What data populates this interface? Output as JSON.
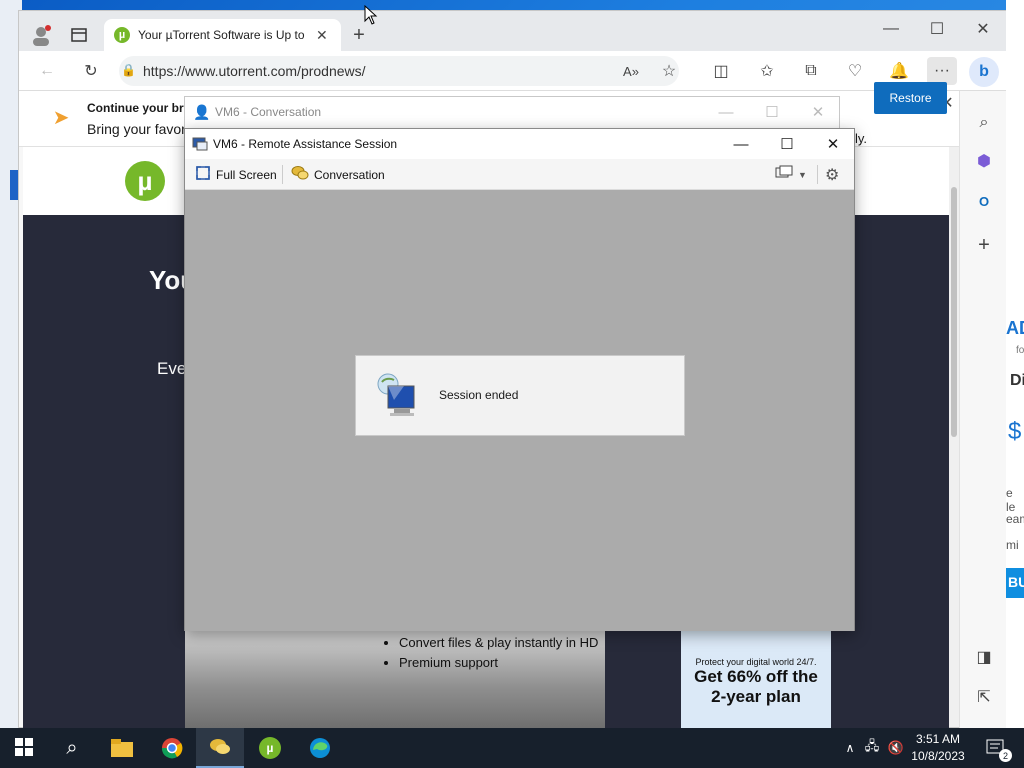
{
  "browser": {
    "tab_title": "Your µTorrent Software is Up to D",
    "url": "https://www.utorrent.com/prodnews/",
    "banner_title": "Continue your bro",
    "banner_text": "Bring your favor",
    "restore_label": "Restore",
    "banner_trailing_text": "ly."
  },
  "page": {
    "hero_title": "You",
    "hero_sub": "Eve",
    "features": [
      "Convert files & play instantly in HD",
      "Premium support"
    ],
    "ad_small": "Protect your digital world 24/7.",
    "ad_big_1": "Get 66% off the",
    "ad_big_2": "2-year plan",
    "right_strip_texts": [
      "AD",
      "fo",
      "Di",
      "$",
      "e le",
      "eam",
      "mi",
      "BU"
    ]
  },
  "conversation_window": {
    "title": "VM6 - Conversation"
  },
  "remote_assistance": {
    "title": "VM6 - Remote Assistance Session",
    "toolbar": {
      "full_screen": "Full Screen",
      "conversation": "Conversation"
    },
    "session_message": "Session ended"
  },
  "taskbar": {
    "time": "3:51 AM",
    "date": "10/8/2023",
    "notification_count": "2"
  },
  "colors": {
    "accent": "#0f6cbd",
    "utorrent_green": "#76b82a",
    "remote_bg": "#ababab",
    "taskbar": "#17202c"
  }
}
